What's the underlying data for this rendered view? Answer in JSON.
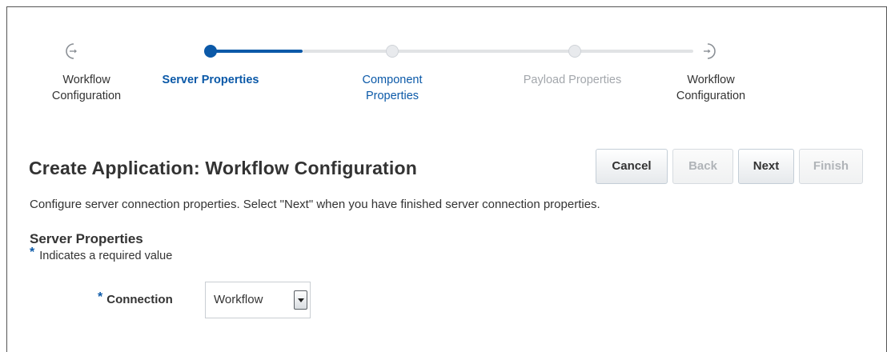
{
  "train": {
    "steps": [
      {
        "label_line1": "Workflow",
        "label_line2": "Configuration",
        "state": "completed",
        "icon": "train-start-icon"
      },
      {
        "label_line1": "Server Properties",
        "label_line2": "",
        "state": "current",
        "icon": ""
      },
      {
        "label_line1": "Component",
        "label_line2": "Properties",
        "state": "next",
        "icon": ""
      },
      {
        "label_line1": "Payload Properties",
        "label_line2": "",
        "state": "disabled",
        "icon": ""
      },
      {
        "label_line1": "Workflow",
        "label_line2": "Configuration",
        "state": "end",
        "icon": "train-end-icon"
      }
    ]
  },
  "header": {
    "title": "Create Application: Workflow Configuration",
    "buttons": {
      "cancel": "Cancel",
      "back": "Back",
      "next": "Next",
      "finish": "Finish"
    }
  },
  "description": "Configure server connection properties. Select \"Next\" when you have finished server connection properties.",
  "section": {
    "title": "Server Properties",
    "required_star": "*",
    "required_note": "Indicates a required value"
  },
  "form": {
    "connection": {
      "required_star": "*",
      "label": "Connection",
      "value": "Workflow"
    }
  },
  "colors": {
    "accent": "#0b59a8",
    "disabled_text": "#a3a7ac",
    "track": "#e1e3e5"
  }
}
